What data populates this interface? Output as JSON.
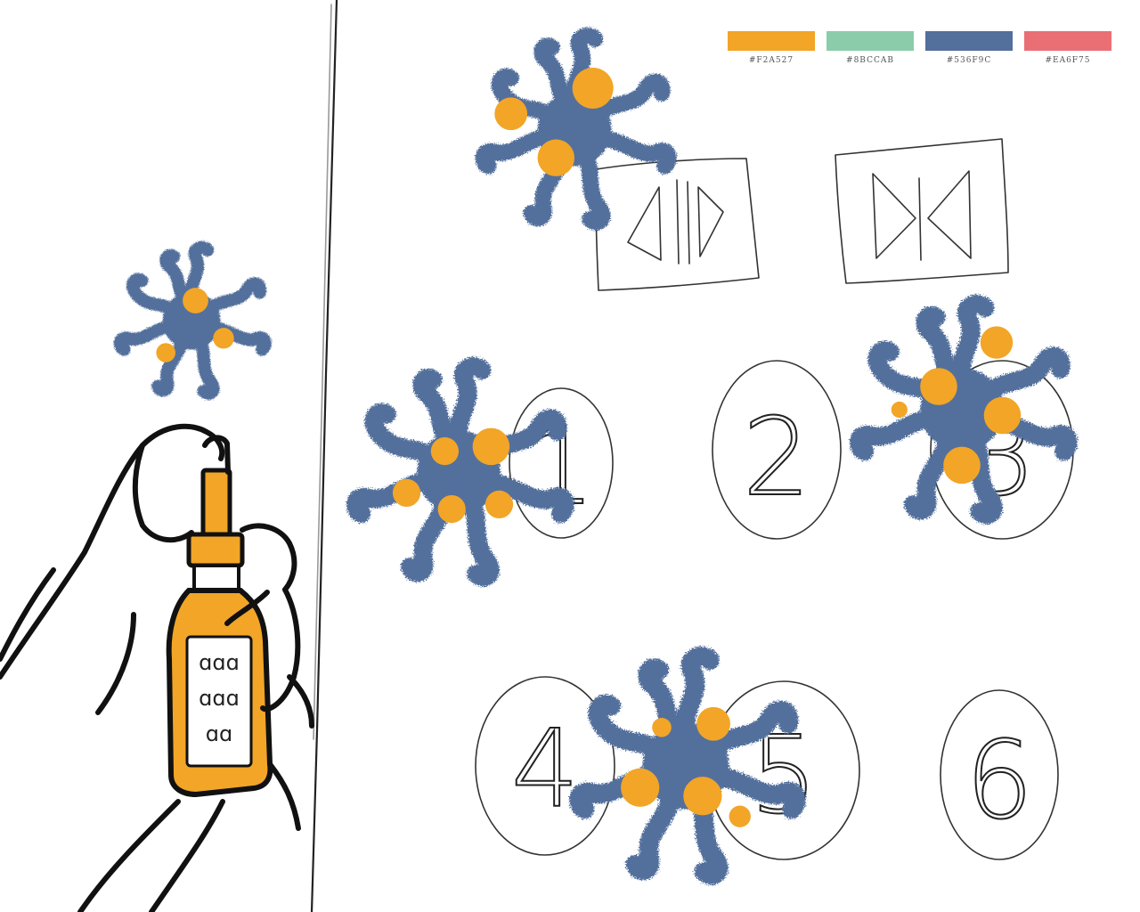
{
  "palette": {
    "swatches": [
      {
        "hex": "#F2A527",
        "label": "#F2A527"
      },
      {
        "hex": "#8BCCAB",
        "label": "#8BCCAB"
      },
      {
        "hex": "#536F9C",
        "label": "#536F9C"
      },
      {
        "hex": "#EA6F75",
        "label": "#EA6F75"
      }
    ]
  },
  "buttons": {
    "door_open_icon": "door-open-icon",
    "door_close_icon": "door-close-icon",
    "floors": [
      "1",
      "2",
      "3",
      "4",
      "5",
      "6"
    ]
  },
  "bottle": {
    "label_text": "ɑɑɑ ɑɑɑ ɑɑ"
  },
  "colors": {
    "germ_blue": "#536F9C",
    "germ_orange": "#F2A527",
    "ink": "#222222"
  }
}
